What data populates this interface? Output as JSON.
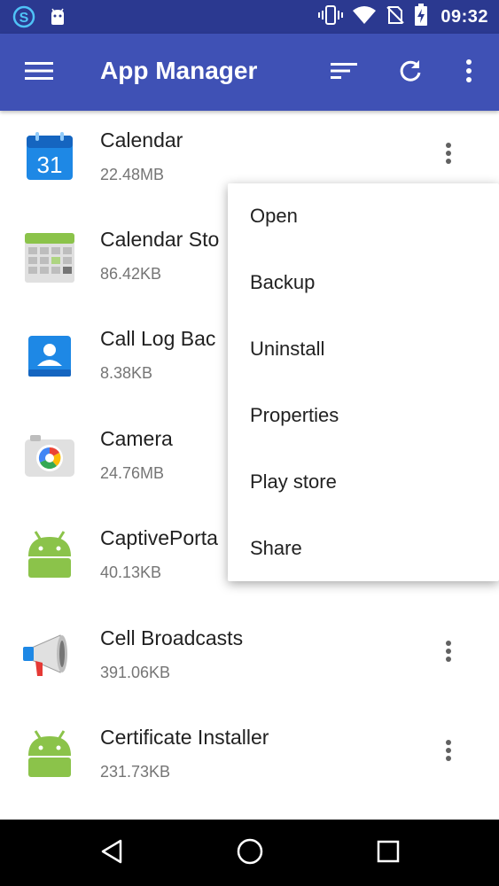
{
  "status_bar": {
    "time": "09:32",
    "left_icons": [
      "s-logo-icon",
      "android-notification-icon"
    ],
    "right_icons": [
      "vibrate-icon",
      "wifi-icon",
      "no-sim-icon",
      "battery-charging-icon"
    ]
  },
  "app_bar": {
    "title": "App Manager",
    "background": "#3f51b5",
    "status_background": "#2b3990",
    "actions": [
      "menu-icon",
      "sort-icon",
      "refresh-icon",
      "overflow-icon"
    ]
  },
  "apps": [
    {
      "name": "Calendar",
      "size": "22.48MB",
      "icon": "calendar-icon",
      "icon_text": "31"
    },
    {
      "name": "Calendar Sto",
      "size": "86.42KB",
      "icon": "calendar-storage-icon"
    },
    {
      "name": "Call Log Bac",
      "size": "8.38KB",
      "icon": "contacts-icon"
    },
    {
      "name": "Camera",
      "size": "24.76MB",
      "icon": "camera-icon"
    },
    {
      "name": "CaptivePorta",
      "size": "40.13KB",
      "icon": "android-icon"
    },
    {
      "name": "Cell Broadcasts",
      "size": "391.06KB",
      "icon": "megaphone-icon"
    },
    {
      "name": "Certificate Installer",
      "size": "231.73KB",
      "icon": "android-icon"
    }
  ],
  "popup_menu": {
    "items": [
      "Open",
      "Backup",
      "Uninstall",
      "Properties",
      "Play store",
      "Share"
    ]
  },
  "nav_bar": {
    "buttons": [
      "back-icon",
      "home-icon",
      "recents-icon"
    ]
  }
}
